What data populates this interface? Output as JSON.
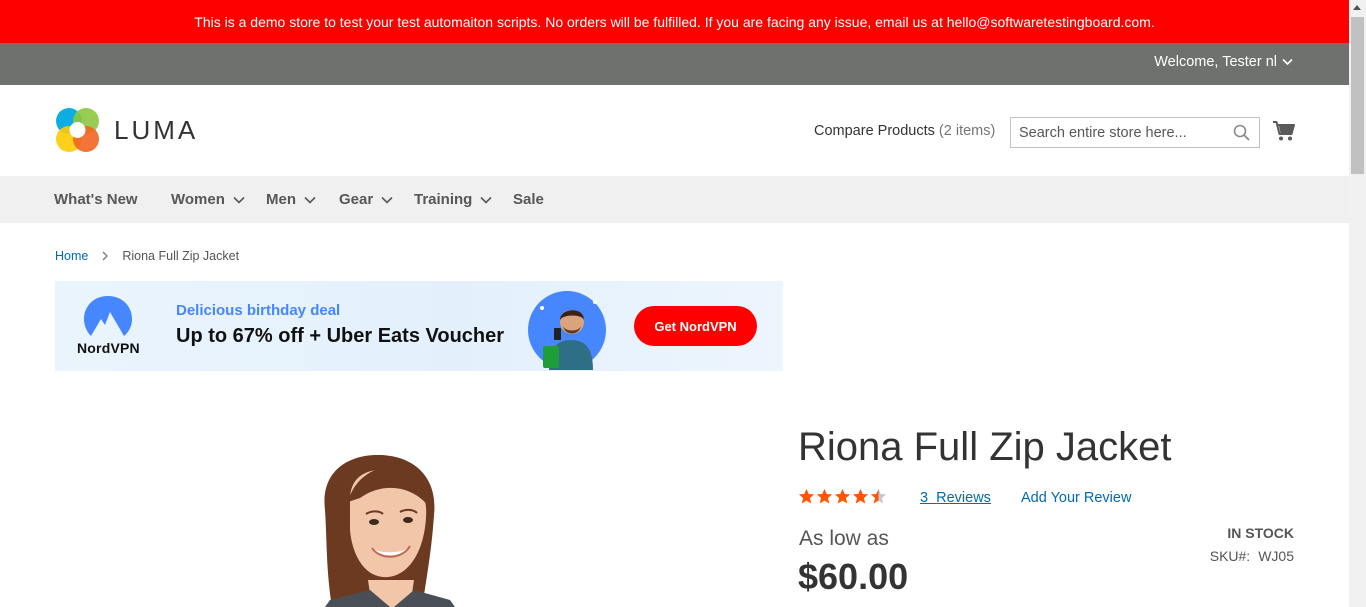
{
  "demo_notice": "This is a demo store to test your test automaiton scripts. No orders will be fulfilled. If you are facing any issue, email us at hello@softwaretestingboard.com.",
  "header": {
    "welcome": "Welcome, Tester nl",
    "logo_text": "LUMA",
    "compare_label": "Compare Products",
    "compare_count": "(2 items)",
    "search_placeholder": "Search entire store here..."
  },
  "nav": {
    "items": [
      {
        "label": "What's New",
        "has_dropdown": false
      },
      {
        "label": "Women",
        "has_dropdown": true
      },
      {
        "label": "Men",
        "has_dropdown": true
      },
      {
        "label": "Gear",
        "has_dropdown": true
      },
      {
        "label": "Training",
        "has_dropdown": true
      },
      {
        "label": "Sale",
        "has_dropdown": false
      }
    ]
  },
  "breadcrumb": {
    "home": "Home",
    "current": "Riona Full Zip Jacket"
  },
  "ad": {
    "brand": "NordVPN",
    "deal": "Delicious birthday deal",
    "headline": "Up to 67% off + Uber Eats Voucher",
    "cta": "Get NordVPN"
  },
  "product": {
    "title": "Riona Full Zip Jacket",
    "rating_stars": 4.5,
    "reviews_count": "3",
    "reviews_label": "Reviews",
    "add_review": "Add Your Review",
    "price_label": "As low as",
    "price": "$60.00",
    "stock": "In stock",
    "sku_label": "SKU#:",
    "sku": "WJ05"
  },
  "colors": {
    "demo_bar": "#ff0000",
    "top_bar": "#6e716e",
    "nav_bg": "#f0f0f0",
    "link": "#006bb4",
    "star": "#ff5501",
    "cta": "#ff0000"
  }
}
